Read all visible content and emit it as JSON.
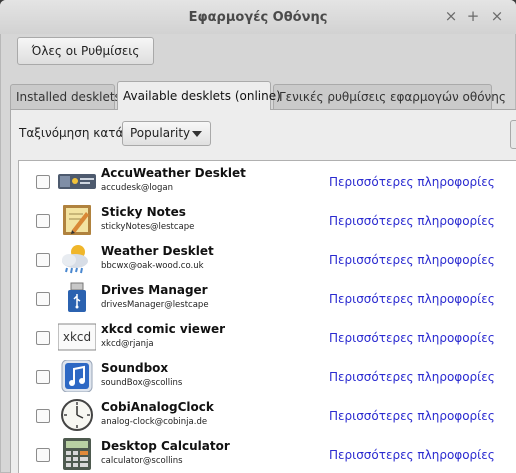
{
  "window": {
    "title": "Εφαρμογές Οθόνης",
    "controls": {
      "minimize": "×",
      "maximize": "+",
      "close": "×"
    }
  },
  "toolbar": {
    "all_settings_label": "Όλες οι Ρυθμίσεις"
  },
  "tabs": [
    {
      "label": "Installed desklets",
      "active": false
    },
    {
      "label": "Available desklets (online)",
      "active": true
    },
    {
      "label": "Γενικές ρυθμίσεις εφαρμογών οθόνης",
      "active": false
    }
  ],
  "sort": {
    "label": "Ταξινόμηση κατά",
    "selected": "Popularity"
  },
  "desklets": [
    {
      "name": "AccuWeather Desklet",
      "uuid": "accudesk@logan",
      "more": "Περισσότερες πληροφορίες",
      "icon": "accuweather-icon",
      "checked": false
    },
    {
      "name": "Sticky Notes",
      "uuid": "stickyNotes@lestcape",
      "more": "Περισσότερες πληροφορίες",
      "icon": "sticky-notes-icon",
      "checked": false
    },
    {
      "name": "Weather Desklet",
      "uuid": "bbcwx@oak-wood.co.uk",
      "more": "Περισσότερες πληροφορίες",
      "icon": "weather-icon",
      "checked": false
    },
    {
      "name": "Drives Manager",
      "uuid": "drivesManager@lestcape",
      "more": "Περισσότερες πληροφορίες",
      "icon": "usb-drive-icon",
      "checked": false
    },
    {
      "name": "xkcd comic viewer",
      "uuid": "xkcd@rjanja",
      "more": "Περισσότερες πληροφορίες",
      "icon": "xkcd-icon",
      "checked": false
    },
    {
      "name": "Soundbox",
      "uuid": "soundBox@scollins",
      "more": "Περισσότερες πληροφορίες",
      "icon": "music-note-icon",
      "checked": false
    },
    {
      "name": "CobiAnalogClock",
      "uuid": "analog-clock@cobinja.de",
      "more": "Περισσότερες πληροφορίες",
      "icon": "clock-icon",
      "checked": false
    },
    {
      "name": "Desktop Calculator",
      "uuid": "calculator@scollins",
      "more": "Περισσότερες πληροφορίες",
      "icon": "calculator-icon",
      "checked": false
    }
  ],
  "icon_text": {
    "xkcd": "xkcd"
  },
  "colors": {
    "link": "#2a2ad0",
    "background": "#d6d6d6",
    "panel": "#ededed"
  }
}
